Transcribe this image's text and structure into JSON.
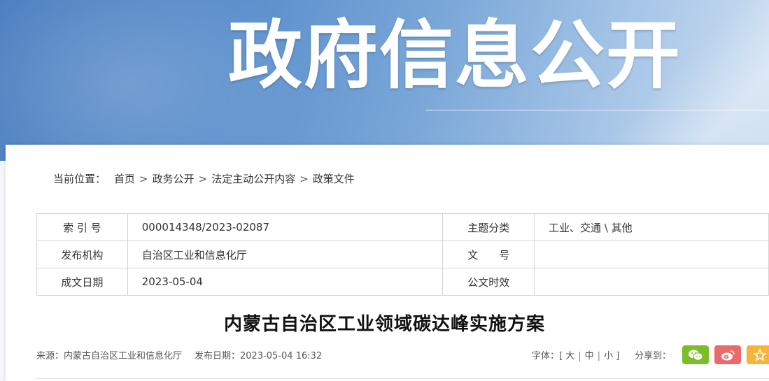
{
  "banner": {
    "title": "政府信息公开"
  },
  "breadcrumb": {
    "prefix": "当前位置：",
    "items": [
      "首页",
      "政务公开",
      "法定主动公开内容",
      "政策文件"
    ],
    "separator": ">"
  },
  "meta": {
    "rows": [
      {
        "k1": "索 引 号",
        "v1": "000014348/2023-02087",
        "k2": "主题分类",
        "v2": "工业、交通 \\ 其他"
      },
      {
        "k1": "发布机构",
        "v1": "自治区工业和信息化厅",
        "k2": "文　　号",
        "v2": ""
      },
      {
        "k1": "成文日期",
        "v1": "2023-05-04",
        "k2": "公文时效",
        "v2": ""
      }
    ]
  },
  "article": {
    "title": "内蒙古自治区工业领域碳达峰实施方案",
    "source": "来源：内蒙古自治区工业和信息化厅",
    "publish": "发布日期：2023-05-04 16:32"
  },
  "font_size": {
    "label": "字体：[",
    "large": "大",
    "medium": "中",
    "small": "小",
    "close": "]"
  },
  "share": {
    "label": "分享到：",
    "buttons": [
      {
        "icon": "wechat-icon",
        "color": "#7bbd2a"
      },
      {
        "icon": "weibo-icon",
        "color": "#e96a6a"
      },
      {
        "icon": "favorite-star-icon",
        "color": "#f5b53d"
      }
    ]
  }
}
